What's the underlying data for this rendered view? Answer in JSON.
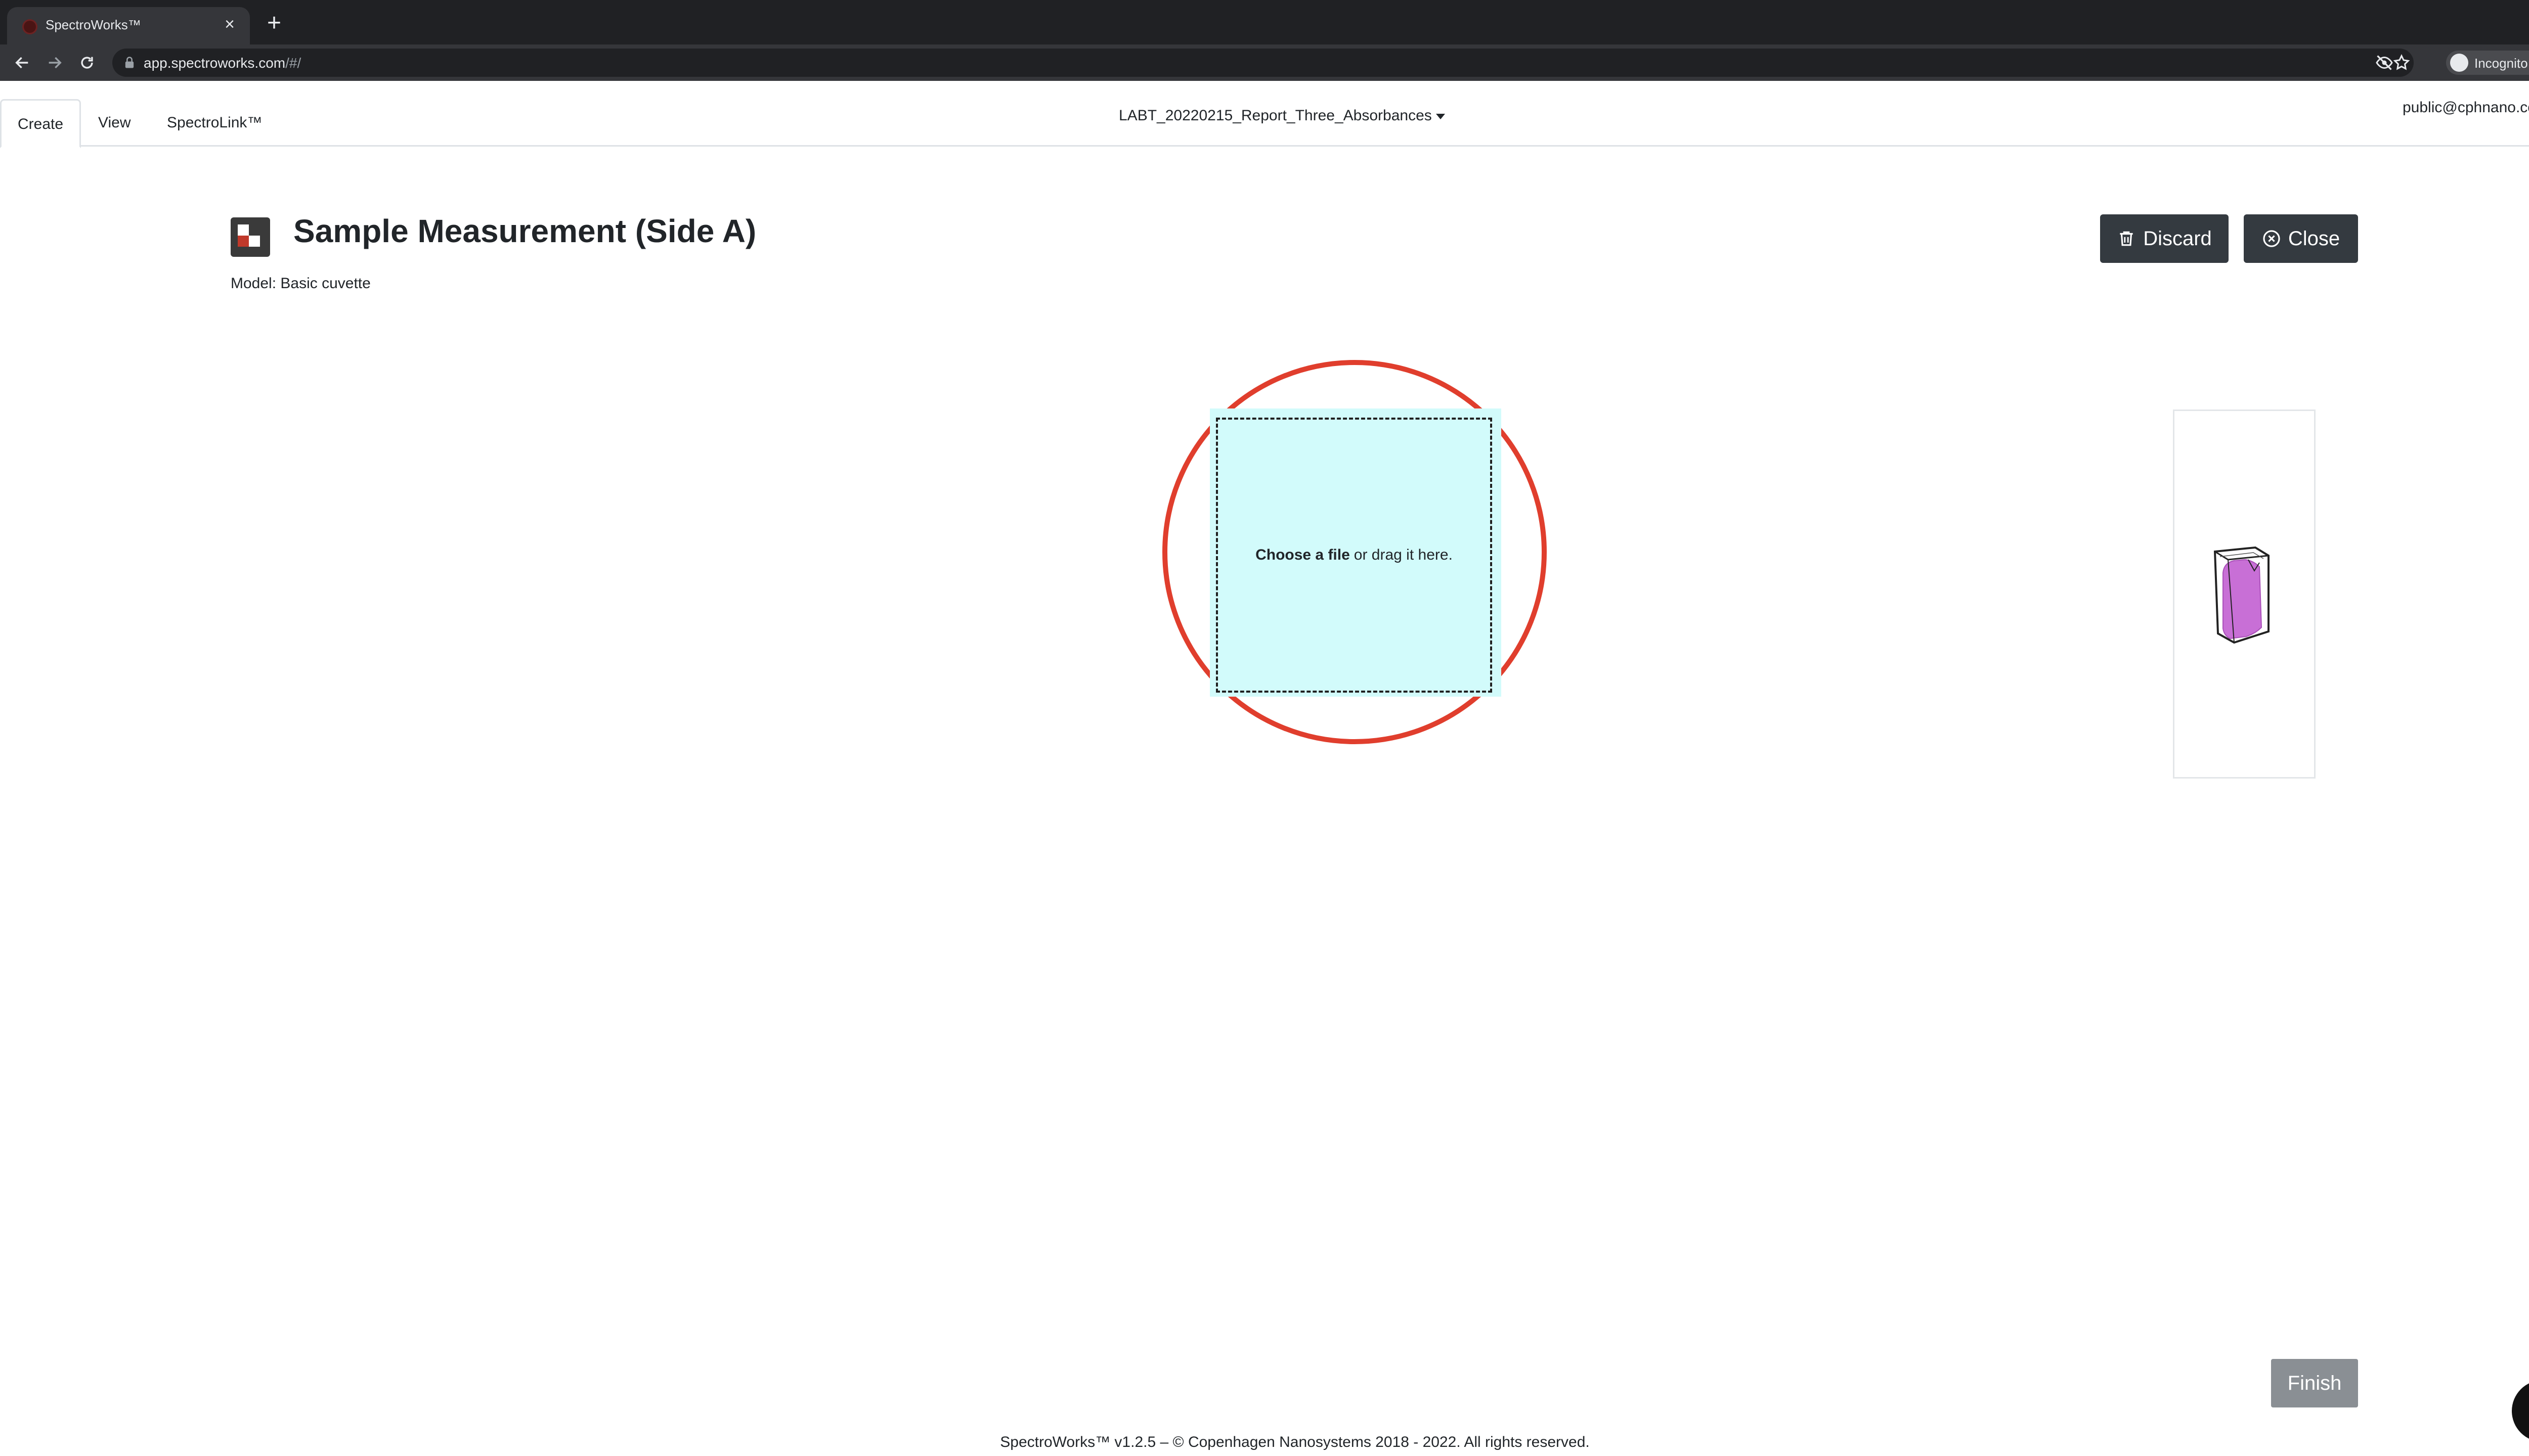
{
  "browser": {
    "tab_title": "SpectroWorks™",
    "tab_close": "×",
    "new_tab": "+",
    "url_host": "app.spectroworks.com",
    "url_path": "/#/",
    "profile_label": "Incognito"
  },
  "appnav": {
    "tabs": [
      {
        "label": "Create",
        "active": true
      },
      {
        "label": "View",
        "active": false
      },
      {
        "label": "SpectroLink™",
        "active": false
      }
    ],
    "report_name": "LABT_20220215_Report_Three_Absorbances",
    "user_email": "public@cphnano.com"
  },
  "header": {
    "title": "Sample Measurement (Side A)",
    "model_line": "Model: Basic cuvette",
    "discard_label": "Discard",
    "close_label": "Close"
  },
  "dropzone": {
    "choose_label": "Choose a file",
    "drag_label": "or drag it here."
  },
  "footer": {
    "finish_label": "Finish",
    "copyright": "SpectroWorks™ v1.2.5 – © Copenhagen Nanosystems 2018 - 2022. All rights reserved."
  },
  "colors": {
    "chrome_dark": "#202124",
    "toolbar": "#35363a",
    "button_dark": "#343a40",
    "dropzone_fill": "#d2fbfb",
    "highlight_ring": "#e03e2d",
    "cuvette_liquid": "#c86fd6",
    "finish_disabled": "#8a8f94"
  },
  "icons": {
    "back": "arrow-left-icon",
    "forward": "arrow-right-icon",
    "reload": "reload-icon",
    "lock": "lock-icon",
    "eye_off": "eye-off-icon",
    "bookmark": "star-icon",
    "discard": "trash-icon",
    "close": "circle-x-icon",
    "chat": "chat-bubble-icon"
  }
}
